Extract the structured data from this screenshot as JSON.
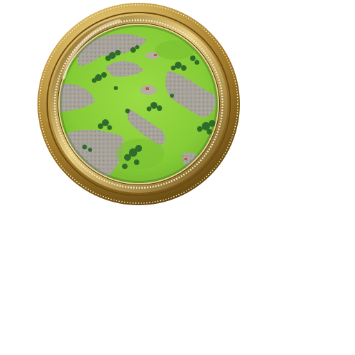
{
  "minimap": {
    "frame_icon": "ornate-gold-round-frame",
    "map_icon": "terrain-minimap",
    "colors": {
      "grass": "#8fd23a",
      "grass_dark": "#5aa02a",
      "rock": "#a8a39a",
      "rock_dark": "#7f7a72",
      "forest": "#2f6b2c",
      "gold_light": "#f1dc9a",
      "gold_mid": "#c9a24a",
      "gold_dark": "#7a5a1d",
      "background": "#ffffff"
    }
  }
}
